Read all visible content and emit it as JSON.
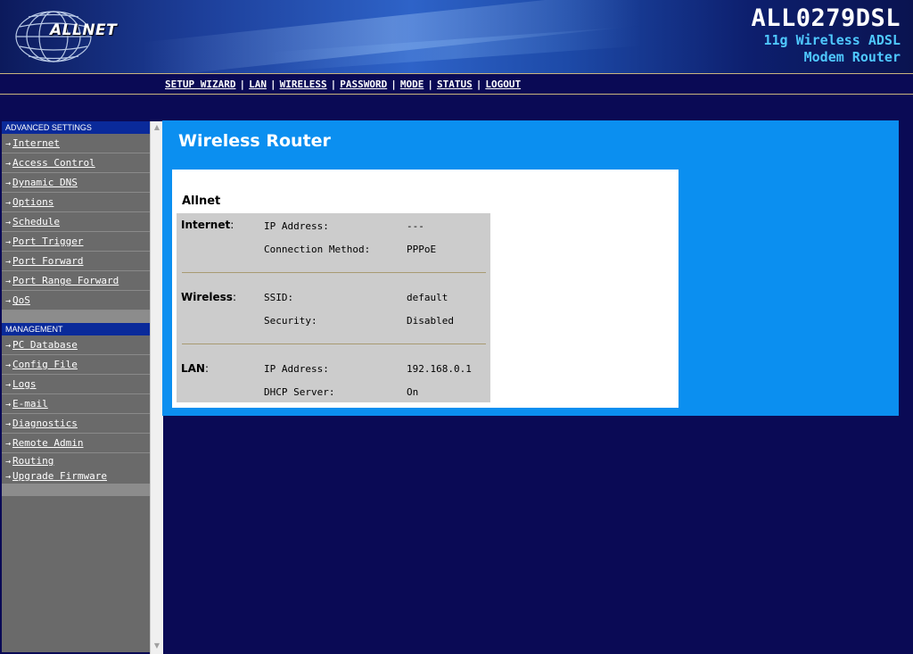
{
  "brand": {
    "logo_text": "ALLNET",
    "model_name": "ALL0279DSL",
    "model_sub1": "11g Wireless ADSL",
    "model_sub2": "Modem Router"
  },
  "topnav": [
    "SETUP WIZARD",
    "LAN",
    "WIRELESS",
    "PASSWORD",
    "MODE",
    "STATUS",
    "LOGOUT"
  ],
  "sidebar": {
    "advanced_header": "ADVANCED SETTINGS",
    "advanced_items": [
      "Internet",
      "Access Control",
      "Dynamic DNS",
      "Options",
      "Schedule",
      "Port Trigger",
      "Port Forward",
      "Port Range Forward",
      "QoS"
    ],
    "management_header": "MANAGEMENT",
    "management_items": [
      "PC Database",
      "Config File",
      "Logs",
      "E-mail",
      "Diagnostics",
      "Remote Admin",
      "Routing",
      "Upgrade Firmware"
    ]
  },
  "main": {
    "title": "Wireless Router",
    "device_name": "Allnet",
    "sections": {
      "internet": {
        "label": "Internet",
        "fields": [
          {
            "name": "IP Address:",
            "value": "---"
          },
          {
            "name": "Connection Method:",
            "value": "PPPoE"
          }
        ]
      },
      "wireless": {
        "label": "Wireless",
        "fields": [
          {
            "name": "SSID:",
            "value": "default"
          },
          {
            "name": "Security:",
            "value": "Disabled"
          }
        ]
      },
      "lan": {
        "label": "LAN",
        "fields": [
          {
            "name": "IP Address:",
            "value": "192.168.0.1"
          },
          {
            "name": "DHCP Server:",
            "value": "On"
          }
        ]
      }
    }
  },
  "colors": {
    "page_bg": "#0a0a55",
    "panel_bg": "#0b8ff0",
    "sidebar_bg": "#6a6a6a",
    "section_header": "#0a2a9a",
    "model_sub": "#4fc8ff"
  }
}
